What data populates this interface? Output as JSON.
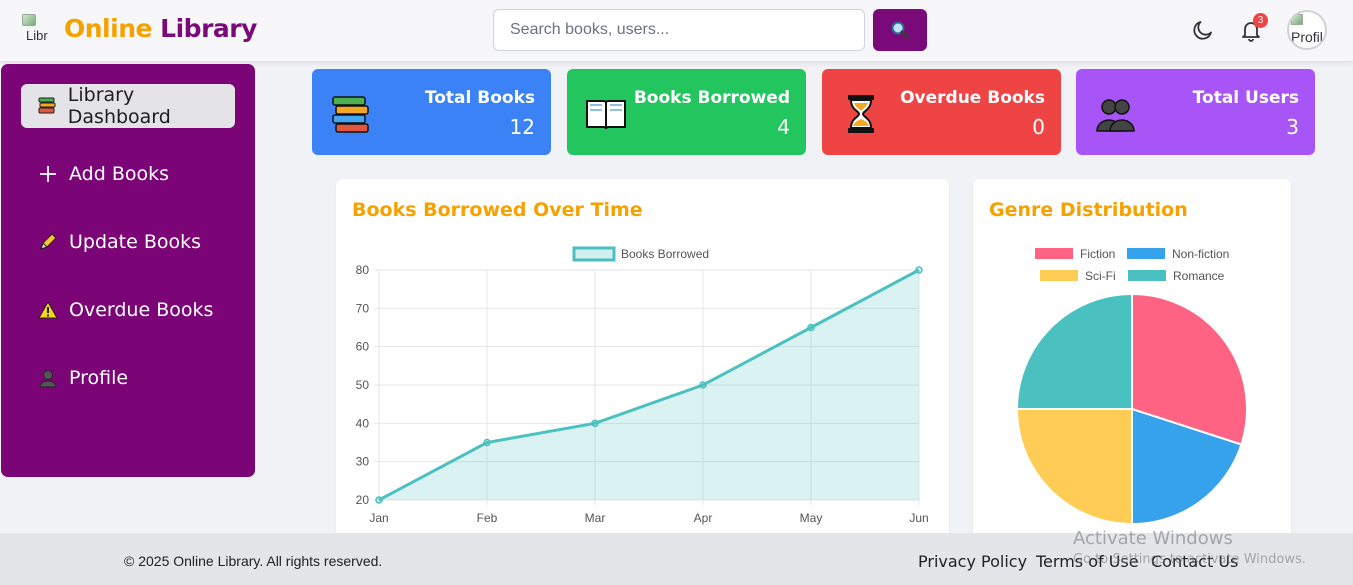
{
  "header": {
    "logo_alt": "Libr",
    "brand_part1": "Online",
    "brand_part2": "Library",
    "search_placeholder": "Search books, users...",
    "search_icon": "magnifier-icon",
    "notification_count": "3",
    "avatar_alt": "Profil"
  },
  "sidebar": {
    "items": [
      {
        "label": "Library Dashboard",
        "icon": "books-stack-icon",
        "active": true
      },
      {
        "label": "Add Books",
        "icon": "plus-icon"
      },
      {
        "label": "Update Books",
        "icon": "pencil-icon"
      },
      {
        "label": "Overdue Books",
        "icon": "warning-icon"
      },
      {
        "label": "Profile",
        "icon": "user-icon"
      }
    ]
  },
  "stats": [
    {
      "label": "Total Books",
      "value": "12",
      "color": "#3b82f6",
      "icon": "books-stack-icon"
    },
    {
      "label": "Books Borrowed",
      "value": "4",
      "color": "#22c55e",
      "icon": "open-book-icon"
    },
    {
      "label": "Overdue Books",
      "value": "0",
      "color": "#ef4444",
      "icon": "hourglass-icon"
    },
    {
      "label": "Total Users",
      "value": "3",
      "color": "#a855f7",
      "icon": "users-icon"
    }
  ],
  "line_panel": {
    "title": "Books Borrowed Over Time"
  },
  "pie_panel": {
    "title": "Genre Distribution"
  },
  "chart_data": [
    {
      "type": "area",
      "title": "Books Borrowed Over Time",
      "categories": [
        "Jan",
        "Feb",
        "Mar",
        "Apr",
        "May",
        "Jun"
      ],
      "series": [
        {
          "name": "Books Borrowed",
          "values": [
            20,
            35,
            40,
            50,
            65,
            80
          ],
          "color": "#4bc0c0"
        }
      ],
      "yticks": [
        20,
        30,
        40,
        50,
        60,
        70,
        80
      ],
      "ylim": [
        20,
        80
      ],
      "grid": true,
      "legend": "top"
    },
    {
      "type": "pie",
      "title": "Genre Distribution",
      "categories": [
        "Fiction",
        "Non-fiction",
        "Sci-Fi",
        "Romance"
      ],
      "values": [
        30,
        20,
        25,
        25
      ],
      "colors": [
        "#ff6384",
        "#36a2eb",
        "#ffcd56",
        "#4bc0c0"
      ],
      "legend": "top"
    }
  ],
  "footer": {
    "copyright": "© 2025 Online Library. All rights reserved.",
    "links": [
      "Privacy Policy",
      "Terms of Use",
      "Contact Us"
    ]
  },
  "watermark": {
    "line1": "Activate Windows",
    "line2": "Go to Settings to activate Windows."
  }
}
